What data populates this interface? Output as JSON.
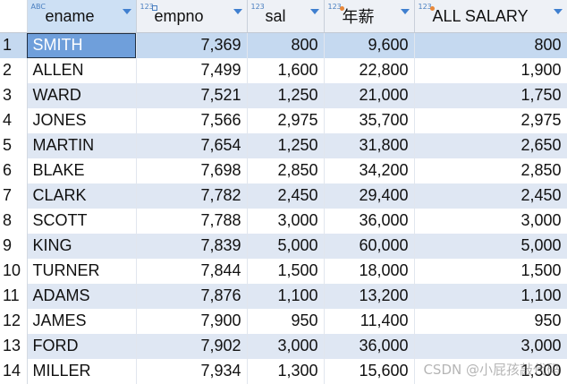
{
  "columns": [
    {
      "name": "ename",
      "type_icon": "ABC",
      "icon": "text-type-icon"
    },
    {
      "name": "empno",
      "type_icon": "123",
      "icon": "number-key-type-icon"
    },
    {
      "name": "sal",
      "type_icon": "123",
      "icon": "number-type-icon"
    },
    {
      "name": "年薪",
      "type_icon": "123",
      "icon": "number-computed-type-icon"
    },
    {
      "name": "ALL SALARY",
      "type_icon": "123",
      "icon": "number-computed-type-icon"
    }
  ],
  "rows": [
    {
      "idx": "1",
      "ename": "SMITH",
      "empno": "7,369",
      "sal": "800",
      "nianxin": "9,600",
      "all_salary": "800"
    },
    {
      "idx": "2",
      "ename": "ALLEN",
      "empno": "7,499",
      "sal": "1,600",
      "nianxin": "22,800",
      "all_salary": "1,900"
    },
    {
      "idx": "3",
      "ename": "WARD",
      "empno": "7,521",
      "sal": "1,250",
      "nianxin": "21,000",
      "all_salary": "1,750"
    },
    {
      "idx": "4",
      "ename": "JONES",
      "empno": "7,566",
      "sal": "2,975",
      "nianxin": "35,700",
      "all_salary": "2,975"
    },
    {
      "idx": "5",
      "ename": "MARTIN",
      "empno": "7,654",
      "sal": "1,250",
      "nianxin": "31,800",
      "all_salary": "2,650"
    },
    {
      "idx": "6",
      "ename": "BLAKE",
      "empno": "7,698",
      "sal": "2,850",
      "nianxin": "34,200",
      "all_salary": "2,850"
    },
    {
      "idx": "7",
      "ename": "CLARK",
      "empno": "7,782",
      "sal": "2,450",
      "nianxin": "29,400",
      "all_salary": "2,450"
    },
    {
      "idx": "8",
      "ename": "SCOTT",
      "empno": "7,788",
      "sal": "3,000",
      "nianxin": "36,000",
      "all_salary": "3,000"
    },
    {
      "idx": "9",
      "ename": "KING",
      "empno": "7,839",
      "sal": "5,000",
      "nianxin": "60,000",
      "all_salary": "5,000"
    },
    {
      "idx": "10",
      "ename": "TURNER",
      "empno": "7,844",
      "sal": "1,500",
      "nianxin": "18,000",
      "all_salary": "1,500"
    },
    {
      "idx": "11",
      "ename": "ADAMS",
      "empno": "7,876",
      "sal": "1,100",
      "nianxin": "13,200",
      "all_salary": "1,100"
    },
    {
      "idx": "12",
      "ename": "JAMES",
      "empno": "7,900",
      "sal": "950",
      "nianxin": "11,400",
      "all_salary": "950"
    },
    {
      "idx": "13",
      "ename": "FORD",
      "empno": "7,902",
      "sal": "3,000",
      "nianxin": "36,000",
      "all_salary": "3,000"
    },
    {
      "idx": "14",
      "ename": "MILLER",
      "empno": "7,934",
      "sal": "1,300",
      "nianxin": "15,600",
      "all_salary": "1,300"
    }
  ],
  "selected_row": 0,
  "watermark": "CSDN @小屁孩敲代码",
  "colors": {
    "header_bg": "#eef1f6",
    "selected_header_bg": "#cde0f4",
    "alt_row_bg": "#dfe7f3",
    "selected_row_bg": "#c5d9f0",
    "current_cell_bg": "#6f9fdb",
    "sort_arrow": "#3f7fcf"
  }
}
